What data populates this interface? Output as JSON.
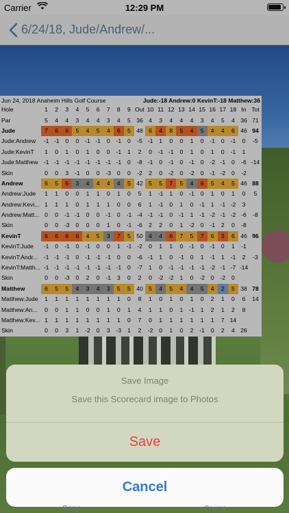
{
  "status_bar": {
    "carrier": "Carrier",
    "time": "12:29 PM",
    "battery_level": 0.9,
    "wifi_icon": "wifi-icon",
    "battery_icon": "battery-icon"
  },
  "nav": {
    "back_icon": "chevron-left-icon",
    "title": "6/24/18, Jude/Andrew/..."
  },
  "scorecard": {
    "course": "Jun 24, 2018 Anaheim Hills Golf Course",
    "summary": "Jude:-18 Andrew:0 KevinT:-18 Matthew:36",
    "columns": [
      "Hole",
      "1",
      "2",
      "3",
      "4",
      "5",
      "6",
      "7",
      "8",
      "9",
      "Out",
      "10",
      "11",
      "12",
      "13",
      "14",
      "15",
      "16",
      "17",
      "18",
      "In",
      "Tot"
    ],
    "rows": [
      {
        "bold": false,
        "cells": [
          "Par",
          "5",
          "4",
          "4",
          "3",
          "4",
          "4",
          "3",
          "4",
          "5",
          "36",
          "4",
          "3",
          "4",
          "4",
          "4",
          "3",
          "4",
          "5",
          "4",
          "36",
          "71"
        ]
      },
      {
        "bold": true,
        "styles": [
          "",
          "b",
          "b",
          "b",
          "p",
          "p",
          "p",
          "p",
          "b",
          "p",
          "",
          "p",
          "b",
          "p",
          "b",
          "b",
          "g",
          "p",
          "p",
          "p",
          "",
          ""
        ],
        "cells": [
          "Jude",
          "7",
          "6",
          "6",
          "5",
          "4",
          "5",
          "4",
          "6",
          "5",
          "48",
          "6",
          "4",
          "8",
          "5",
          "4",
          "5",
          "4",
          "4",
          "6",
          "46",
          "94"
        ]
      },
      {
        "bold": false,
        "cells": [
          "Jude:Andrew",
          "-1",
          "-1",
          "0",
          "0",
          "-1",
          "-1",
          "0",
          "-1",
          "0",
          "-5",
          "-1",
          "1",
          "0",
          "0",
          "1",
          "0",
          "-1",
          "0",
          "-1",
          "0",
          "-5"
        ]
      },
      {
        "bold": false,
        "cells": [
          "Jude:KevinT",
          "1",
          "0",
          "1",
          "0",
          "1",
          "0",
          "0",
          "-1",
          "1",
          "2",
          "0",
          "-1",
          "-1",
          "0",
          "1",
          "0",
          "1",
          "0",
          "-1",
          "1",
          ""
        ]
      },
      {
        "bold": false,
        "cells": [
          "Jude:Matthew",
          "-1",
          "-1",
          "-1",
          "-1",
          "-1",
          "-1",
          "-1",
          "-1",
          "0",
          "-8",
          "-1",
          "0",
          "-1",
          "0",
          "-1",
          "0",
          "-2",
          "-1",
          "0",
          "-6",
          "-14"
        ]
      },
      {
        "bold": false,
        "cells": [
          "Skin",
          "0",
          "0",
          "3",
          "-1",
          "0",
          "0",
          "-3",
          "0",
          "0",
          "-2",
          "2",
          "0",
          "-2",
          "0",
          "-2",
          "0",
          "-1",
          "-2",
          "0",
          "-2",
          ""
        ]
      },
      {
        "bold": true,
        "styles": [
          "",
          "p",
          "p",
          "b",
          "g",
          "g",
          "p",
          "p",
          "g",
          "p",
          "",
          "p",
          "p",
          "b",
          "p",
          "g",
          "b",
          "p",
          "p",
          "p",
          "",
          ""
        ],
        "cells": [
          "Andrew",
          "6",
          "5",
          "6",
          "3",
          "4",
          "4",
          "4",
          "4",
          "5",
          "42",
          "5",
          "5",
          "7",
          "5",
          "4",
          "6",
          "5",
          "4",
          "5",
          "46",
          "88"
        ]
      },
      {
        "bold": false,
        "cells": [
          "Andrew:Jude",
          "1",
          "1",
          "0",
          "0",
          "1",
          "1",
          "0",
          "1",
          "0",
          "5",
          "1",
          "-1",
          "1",
          "0",
          "-1",
          "0",
          "1",
          "0",
          "1",
          "0",
          "5"
        ]
      },
      {
        "bold": false,
        "cells": [
          "Andrew:Kevi...",
          "1",
          "1",
          "1",
          "0",
          "1",
          "1",
          "1",
          "0",
          "0",
          "6",
          "1",
          "-1",
          "0",
          "1",
          "0",
          "-1",
          "1",
          "-1",
          "-2",
          "3",
          ""
        ]
      },
      {
        "bold": false,
        "cells": [
          "Andrew:Matt...",
          "0",
          "0",
          "-1",
          "-1",
          "0",
          "0",
          "-1",
          "0",
          "-1",
          "-4",
          "-1",
          "-1",
          "0",
          "-1",
          "1",
          "-1",
          "-2",
          "-1",
          "-2",
          "-6",
          "-8"
        ]
      },
      {
        "bold": false,
        "cells": [
          "Skin",
          "0",
          "0",
          "-3",
          "0",
          "0",
          "0",
          "1",
          "0",
          "-1",
          "-6",
          "2",
          "2",
          "0",
          "1",
          "-2",
          "0",
          "-1",
          "2",
          "0",
          "-8",
          ""
        ]
      },
      {
        "bold": true,
        "styles": [
          "",
          "b",
          "b",
          "b",
          "b",
          "p",
          "p",
          "g",
          "b",
          "p",
          "",
          "g",
          "g",
          "b",
          "p",
          "p",
          "b",
          "p",
          "b",
          "p",
          "",
          ""
        ],
        "cells": [
          "KevinT",
          "6",
          "6",
          "6",
          "6",
          "4",
          "5",
          "3",
          "7",
          "5",
          "50",
          "4",
          "4",
          "6",
          "7",
          "5",
          "7",
          "6",
          "3",
          "6",
          "46",
          "96"
        ]
      },
      {
        "bold": false,
        "cells": [
          "KevinT:Jude",
          "-1",
          "0",
          "-1",
          "0",
          "-1",
          "0",
          "0",
          "1",
          "-1",
          "-2",
          "0",
          "1",
          "1",
          "0",
          "-1",
          "0",
          "-1",
          "0",
          "1",
          "-1",
          ""
        ]
      },
      {
        "bold": false,
        "cells": [
          "KevinT:Andr...",
          "-1",
          "-1",
          "-1",
          "0",
          "-1",
          "-1",
          "-1",
          "0",
          "0",
          "-6",
          "-1",
          "1",
          "0",
          "-1",
          "0",
          "1",
          "-1",
          "1",
          "-1",
          "2",
          "-3"
        ]
      },
      {
        "bold": false,
        "cells": [
          "KevinT:Matth...",
          "-1",
          "-1",
          "-1",
          "-1",
          "-1",
          "-1",
          "-1",
          "-1",
          "0",
          "-7",
          "1",
          "0",
          "-1",
          "-1",
          "-1",
          "-1",
          "-2",
          "-1",
          "-7",
          "-14",
          ""
        ]
      },
      {
        "bold": false,
        "cells": [
          "Skin",
          "0",
          "0",
          "-3",
          "0",
          "2",
          "0",
          "-1",
          "3",
          "0",
          "2",
          "0",
          "-2",
          "-2",
          "1",
          "0",
          "-2",
          "0",
          "-2",
          "0",
          "",
          ""
        ]
      },
      {
        "bold": true,
        "styles": [
          "",
          "p",
          "p",
          "p",
          "g",
          "g",
          "g",
          "g",
          "p",
          "p",
          "",
          "p",
          "g",
          "p",
          "p",
          "g",
          "g",
          "p",
          "l",
          "p",
          "",
          ""
        ],
        "cells": [
          "Matthew",
          "6",
          "5",
          "5",
          "4",
          "3",
          "4",
          "3",
          "5",
          "5",
          "40",
          "5",
          "4",
          "5",
          "4",
          "4",
          "5",
          "4",
          "2",
          "5",
          "38",
          "78"
        ]
      },
      {
        "bold": false,
        "cells": [
          "Matthew:Jude",
          "1",
          "1",
          "1",
          "1",
          "1",
          "1",
          "1",
          "1",
          "0",
          "8",
          "1",
          "0",
          "1",
          "0",
          "1",
          "0",
          "2",
          "1",
          "0",
          "6",
          "14"
        ]
      },
      {
        "bold": false,
        "cells": [
          "Matthew:An...",
          "0",
          "0",
          "1",
          "1",
          "0",
          "0",
          "1",
          "0",
          "1",
          "4",
          "1",
          "1",
          "0",
          "1",
          "-1",
          "1",
          "2",
          "1",
          "2",
          "8",
          ""
        ]
      },
      {
        "bold": false,
        "cells": [
          "Matthew:Kev...",
          "1",
          "1",
          "1",
          "1",
          "1",
          "1",
          "1",
          "1",
          "0",
          "7",
          "0",
          "1",
          "1",
          "1",
          "1",
          "1",
          "1",
          "7",
          "14",
          "",
          ""
        ]
      },
      {
        "bold": false,
        "cells": [
          "Skin",
          "0",
          "0",
          "3",
          "1",
          "-2",
          "0",
          "3",
          "-3",
          "1",
          "2",
          "-2",
          "0",
          "1",
          "0",
          "2",
          "-1",
          "0",
          "2",
          "4",
          "26",
          ""
        ]
      }
    ]
  },
  "action_sheet": {
    "title": "Save Image",
    "message": "Save this Scorecard image to Photos",
    "save_label": "Save",
    "cancel_label": "Cancel"
  },
  "tab_bar": {
    "game_label": "Game",
    "course_label": "Course"
  }
}
